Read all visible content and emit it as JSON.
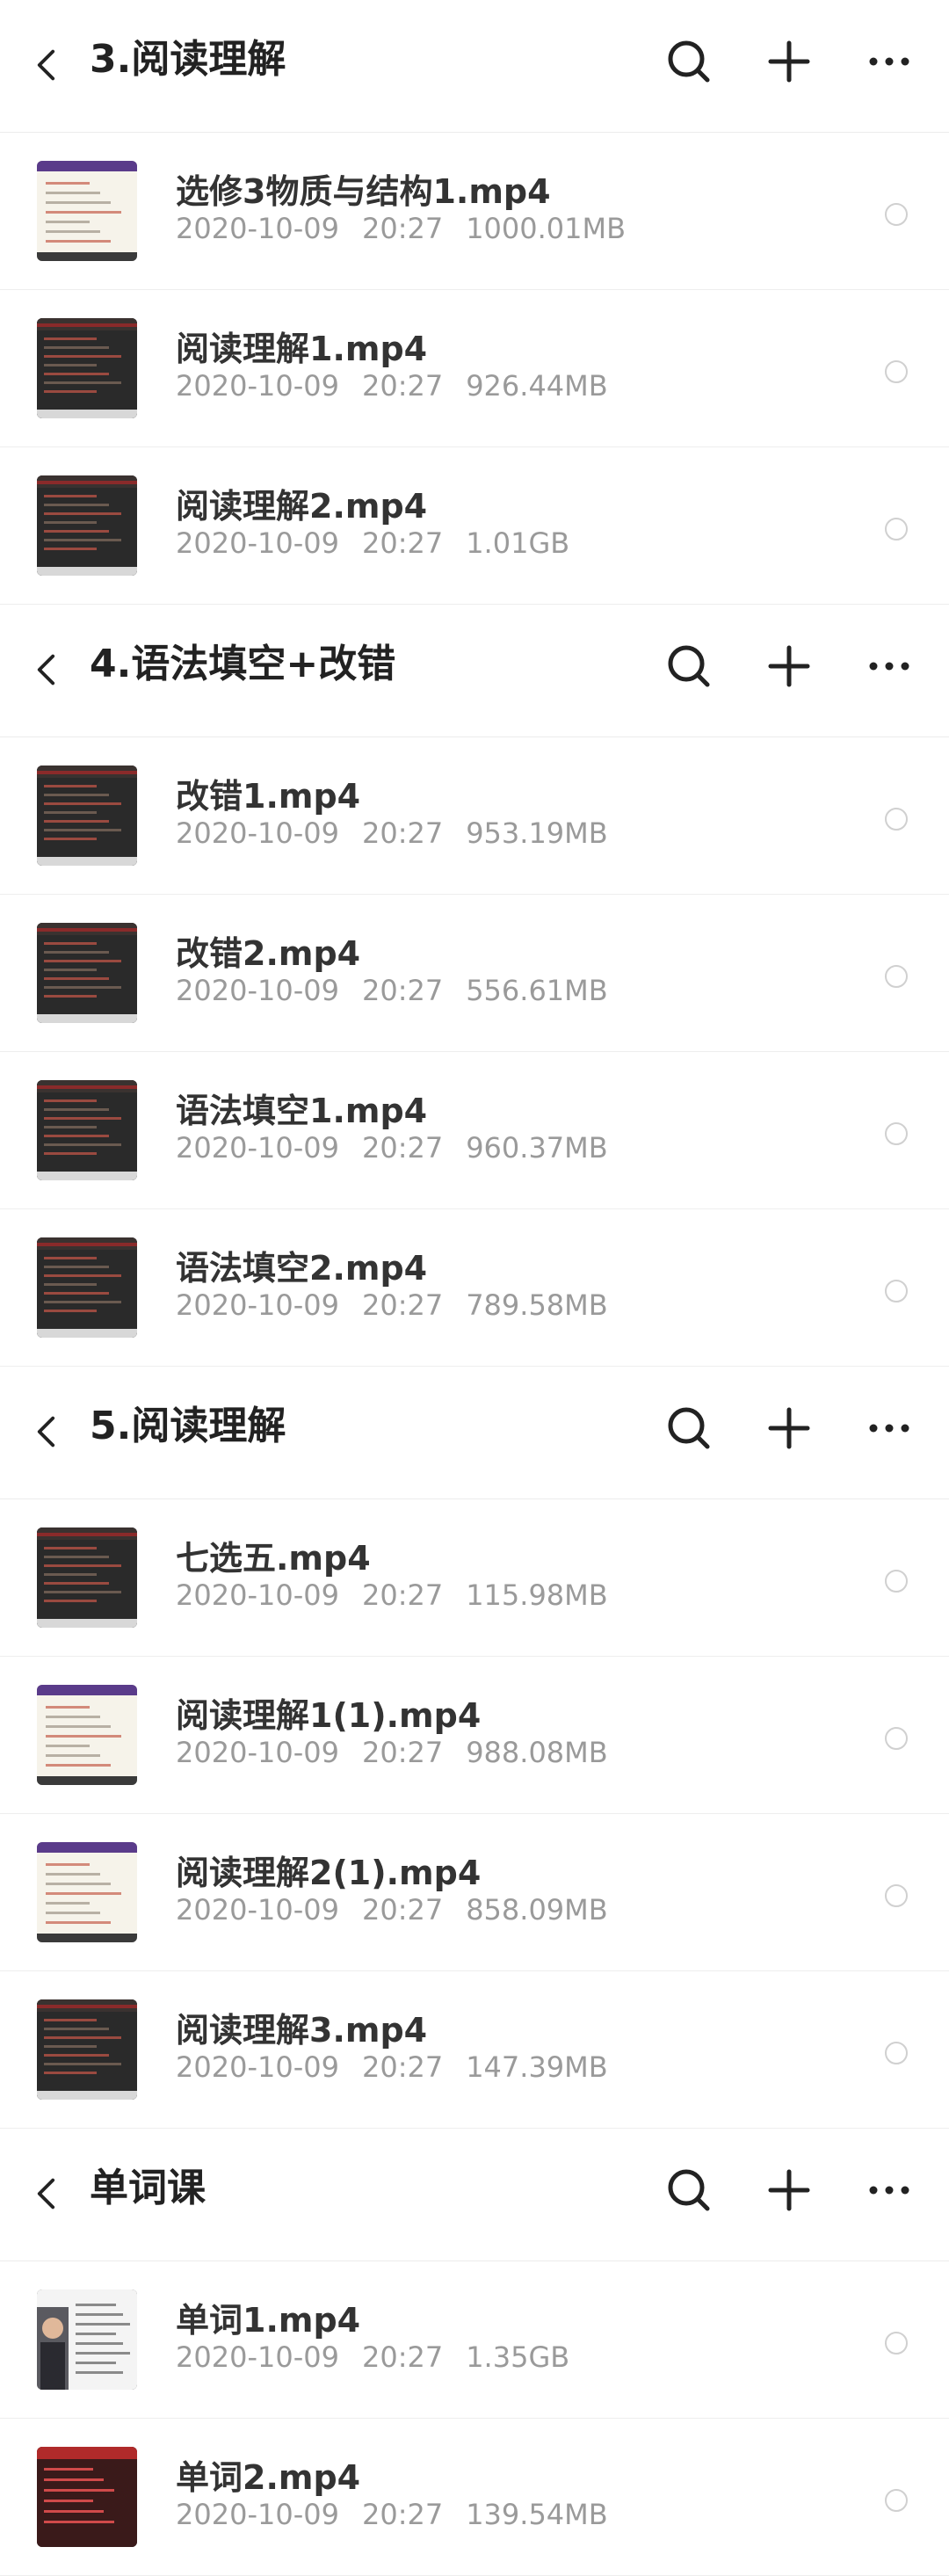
{
  "sections": [
    {
      "title": "3.阅读理解",
      "items": [
        {
          "name": "选修3物质与结构1.mp4",
          "date": "2020-10-09",
          "time": "20:27",
          "size": "1000.01MB",
          "thumb": "light"
        },
        {
          "name": "阅读理解1.mp4",
          "date": "2020-10-09",
          "time": "20:27",
          "size": "926.44MB",
          "thumb": "dark"
        },
        {
          "name": "阅读理解2.mp4",
          "date": "2020-10-09",
          "time": "20:27",
          "size": "1.01GB",
          "thumb": "dark"
        }
      ]
    },
    {
      "title": "4.语法填空+改错",
      "items": [
        {
          "name": "改错1.mp4",
          "date": "2020-10-09",
          "time": "20:27",
          "size": "953.19MB",
          "thumb": "dark"
        },
        {
          "name": "改错2.mp4",
          "date": "2020-10-09",
          "time": "20:27",
          "size": "556.61MB",
          "thumb": "dark"
        },
        {
          "name": "语法填空1.mp4",
          "date": "2020-10-09",
          "time": "20:27",
          "size": "960.37MB",
          "thumb": "dark"
        },
        {
          "name": "语法填空2.mp4",
          "date": "2020-10-09",
          "time": "20:27",
          "size": "789.58MB",
          "thumb": "dark"
        }
      ]
    },
    {
      "title": "5.阅读理解",
      "items": [
        {
          "name": "七选五.mp4",
          "date": "2020-10-09",
          "time": "20:27",
          "size": "115.98MB",
          "thumb": "dark"
        },
        {
          "name": "阅读理解1(1).mp4",
          "date": "2020-10-09",
          "time": "20:27",
          "size": "988.08MB",
          "thumb": "light"
        },
        {
          "name": "阅读理解2(1).mp4",
          "date": "2020-10-09",
          "time": "20:27",
          "size": "858.09MB",
          "thumb": "light"
        },
        {
          "name": "阅读理解3.mp4",
          "date": "2020-10-09",
          "time": "20:27",
          "size": "147.39MB",
          "thumb": "dark"
        }
      ]
    },
    {
      "title": "单词课",
      "items": [
        {
          "name": "单词1.mp4",
          "date": "2020-10-09",
          "time": "20:27",
          "size": "1.35GB",
          "thumb": "person"
        },
        {
          "name": "单词2.mp4",
          "date": "2020-10-09",
          "time": "20:27",
          "size": "139.54MB",
          "thumb": "red"
        }
      ]
    }
  ],
  "icons": {
    "back": "chevron-left-icon",
    "search": "search-icon",
    "add": "plus-icon",
    "more": "more-dots-icon",
    "select": "radio-circle-icon"
  },
  "colors": {
    "title": "#222222",
    "filename": "#333333",
    "meta": "#9a9a9a",
    "divider": "#eeeeee",
    "radio": "#d0d0d0"
  }
}
